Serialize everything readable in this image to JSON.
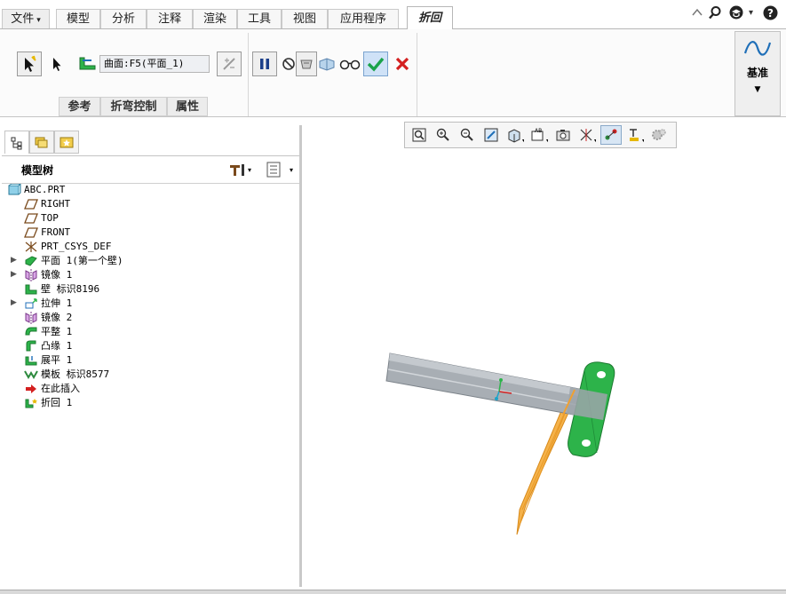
{
  "tabs": {
    "file": "文件",
    "items": [
      "模型",
      "分析",
      "注释",
      "渲染",
      "工具",
      "视图",
      "应用程序"
    ],
    "active": "折回"
  },
  "ribbon": {
    "collector_text": "曲面:F5(平面_1)",
    "group_tabs": [
      "参考",
      "折弯控制",
      "属性"
    ],
    "datum_label": "基准"
  },
  "model_tree": {
    "title": "模型树",
    "nodes": [
      {
        "label": "ABC.PRT",
        "icon": "part-icon",
        "expandable": false
      },
      {
        "label": "RIGHT",
        "icon": "datum-plane-icon",
        "expandable": false
      },
      {
        "label": "TOP",
        "icon": "datum-plane-icon",
        "expandable": false
      },
      {
        "label": "FRONT",
        "icon": "datum-plane-icon",
        "expandable": false
      },
      {
        "label": "PRT_CSYS_DEF",
        "icon": "csys-icon",
        "expandable": false
      },
      {
        "label": "平面 1(第一个壁)",
        "icon": "flat-wall-icon",
        "expandable": true
      },
      {
        "label": "镜像 1",
        "icon": "mirror-icon",
        "expandable": true
      },
      {
        "label": "壁 标识8196",
        "icon": "wall-icon",
        "expandable": false
      },
      {
        "label": "拉伸 1",
        "icon": "extrude-icon",
        "expandable": true
      },
      {
        "label": "镜像 2",
        "icon": "mirror-icon",
        "expandable": false
      },
      {
        "label": "平整 1",
        "icon": "flatten-icon",
        "expandable": false
      },
      {
        "label": "凸缘 1",
        "icon": "flange-icon",
        "expandable": false
      },
      {
        "label": "展平 1",
        "icon": "unbend-icon",
        "expandable": false
      },
      {
        "label": "模板 标识8577",
        "icon": "template-icon",
        "expandable": false
      },
      {
        "label": "在此插入",
        "icon": "insert-here-icon",
        "expandable": false
      },
      {
        "label": "折回 1",
        "icon": "bend-back-icon",
        "expandable": false
      }
    ]
  },
  "colors": {
    "accent_blue": "#1f6fb8",
    "model_gray": "#9aa0a6",
    "model_green": "#2db34a",
    "model_orange": "#f0a030",
    "ok_green": "#1aa34a",
    "cancel_red": "#d42020"
  }
}
